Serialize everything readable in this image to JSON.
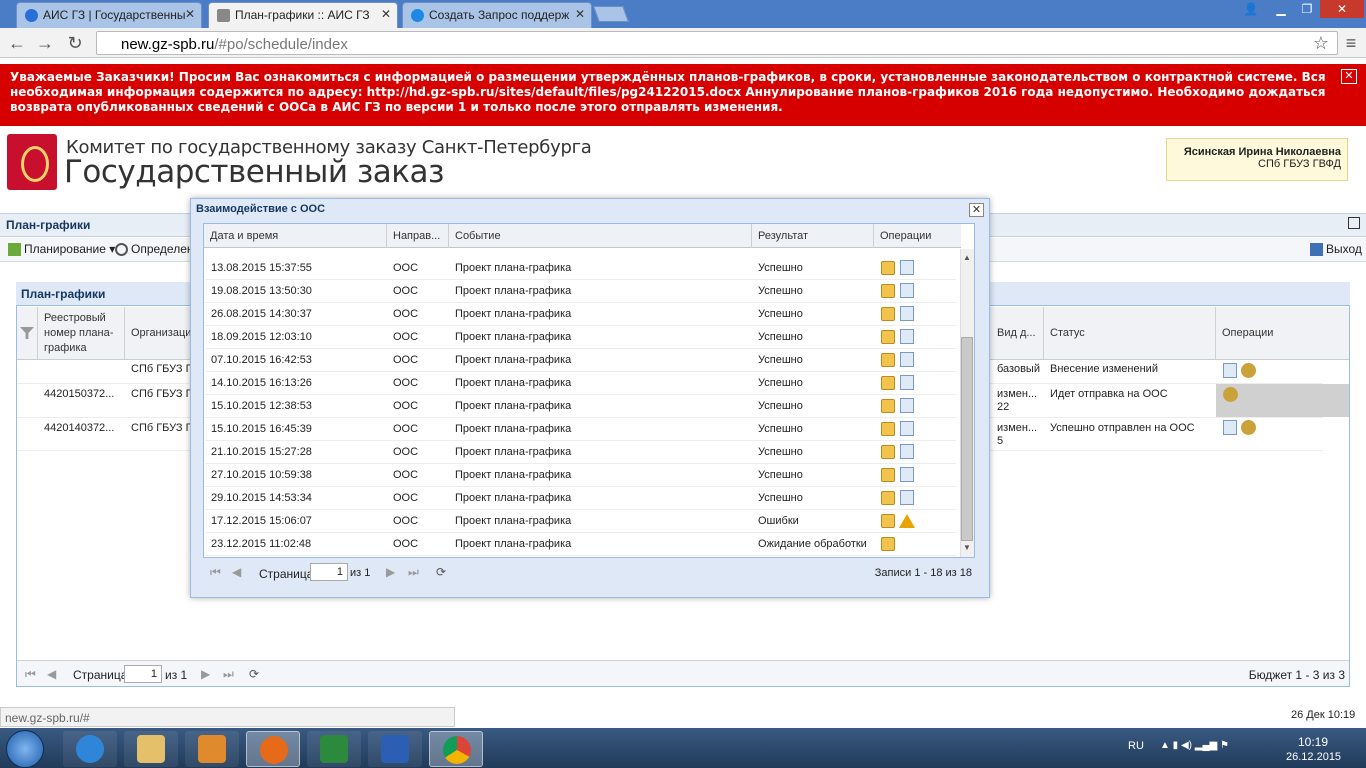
{
  "browser": {
    "tabs": [
      {
        "label": "АИС ГЗ | Государственны",
        "active": false
      },
      {
        "label": "План-графики :: АИС ГЗ",
        "active": true
      },
      {
        "label": "Создать Запрос поддерж",
        "active": false
      }
    ],
    "url_domain": "new.gz-spb.ru",
    "url_path": "/#po/schedule/index",
    "window_buttons": {
      "user": "👤",
      "minimize": "▁",
      "restore": "❐",
      "close": "✕"
    },
    "nav": {
      "back": "←",
      "forward": "→",
      "reload": "↻",
      "star": "☆",
      "menu": "≡"
    }
  },
  "banner": {
    "text": "Уважаемые Заказчики! Просим Вас ознакомиться с информацией о размещении утверждённых планов-графиков, в сроки, установленные законодательством о контрактной системе. Вся необходимая информация содержится по адресу: http://hd.gz-spb.ru/sites/default/files/pg24122015.docx Аннулирование планов-графиков 2016 года недопустимо. Необходимо дождаться возврата опубликованных сведений с ООСа в АИС ГЗ по версии 1 и только после этого отправлять изменения.",
    "close": "✕"
  },
  "header": {
    "org_line1": "Комитет по государственному заказу Санкт-Петербурга",
    "org_line2": "Государственный заказ",
    "user_name": "Ясинская Ирина Николаевна",
    "user_org": "СПб ГБУЗ ГВФД"
  },
  "panel": {
    "title": "План-графики",
    "tools": {
      "planning": "Планирование ▾",
      "define": "Определени",
      "exit": "Выход"
    }
  },
  "grid": {
    "title": "План-графики",
    "columns": [
      "Реестровый номер плана-графика",
      "Организаци",
      "Вид д...",
      "Статус",
      "Операции"
    ],
    "rows": [
      {
        "reg": "",
        "org": "СПб ГБУЗ Г",
        "kind": "базовый",
        "status": "Внесение изменений"
      },
      {
        "reg": "4420150372...",
        "org": "СПб ГБУЗ Г",
        "kind": "измен... 22",
        "status": "Идет отправка на ООС"
      },
      {
        "reg": "4420140372...",
        "org": "СПб ГБУЗ Г",
        "kind": "измен... 5",
        "status": "Успешно отправлен на ООС"
      }
    ],
    "pager": {
      "page_label": "Страница",
      "page": "1",
      "of": "из 1",
      "summary": "Бюджет 1 - 3 из 3"
    }
  },
  "modal": {
    "title": "Взаимодействие с ООС",
    "close": "✕",
    "columns": [
      "Дата и время",
      "Направ...",
      "Событие",
      "Результат",
      "Операции"
    ],
    "rows": [
      {
        "dt": "13.08.2015 15:37:55",
        "dir": "ООС",
        "event": "Проект плана-графика",
        "result": "Успешно",
        "op2": "doc"
      },
      {
        "dt": "19.08.2015 13:50:30",
        "dir": "ООС",
        "event": "Проект плана-графика",
        "result": "Успешно",
        "op2": "doc"
      },
      {
        "dt": "26.08.2015 14:30:37",
        "dir": "ООС",
        "event": "Проект плана-графика",
        "result": "Успешно",
        "op2": "doc"
      },
      {
        "dt": "18.09.2015 12:03:10",
        "dir": "ООС",
        "event": "Проект плана-графика",
        "result": "Успешно",
        "op2": "doc"
      },
      {
        "dt": "07.10.2015 16:42:53",
        "dir": "ООС",
        "event": "Проект плана-графика",
        "result": "Успешно",
        "op2": "doc"
      },
      {
        "dt": "14.10.2015 16:13:26",
        "dir": "ООС",
        "event": "Проект плана-графика",
        "result": "Успешно",
        "op2": "doc"
      },
      {
        "dt": "15.10.2015 12:38:53",
        "dir": "ООС",
        "event": "Проект плана-графика",
        "result": "Успешно",
        "op2": "doc"
      },
      {
        "dt": "15.10.2015 16:45:39",
        "dir": "ООС",
        "event": "Проект плана-графика",
        "result": "Успешно",
        "op2": "doc"
      },
      {
        "dt": "21.10.2015 15:27:28",
        "dir": "ООС",
        "event": "Проект плана-графика",
        "result": "Успешно",
        "op2": "doc"
      },
      {
        "dt": "27.10.2015 10:59:38",
        "dir": "ООС",
        "event": "Проект плана-графика",
        "result": "Успешно",
        "op2": "doc"
      },
      {
        "dt": "29.10.2015 14:53:34",
        "dir": "ООС",
        "event": "Проект плана-графика",
        "result": "Успешно",
        "op2": "doc"
      },
      {
        "dt": "17.12.2015 15:06:07",
        "dir": "ООС",
        "event": "Проект плана-графика",
        "result": "Ошибки",
        "op2": "warn"
      },
      {
        "dt": "23.12.2015 11:02:48",
        "dir": "ООС",
        "event": "Проект плана-графика",
        "result": "Ожидание обработки",
        "op2": "none"
      }
    ],
    "pager": {
      "page_label": "Страница",
      "page": "1",
      "of": "из 1",
      "summary": "Записи 1 - 18 из 18"
    }
  },
  "statusbar": {
    "url": "new.gz-spb.ru/#",
    "datetime": "26 Дек 10:19"
  },
  "taskbar": {
    "lang": "RU",
    "time": "10:19",
    "date": "26.12.2015"
  }
}
